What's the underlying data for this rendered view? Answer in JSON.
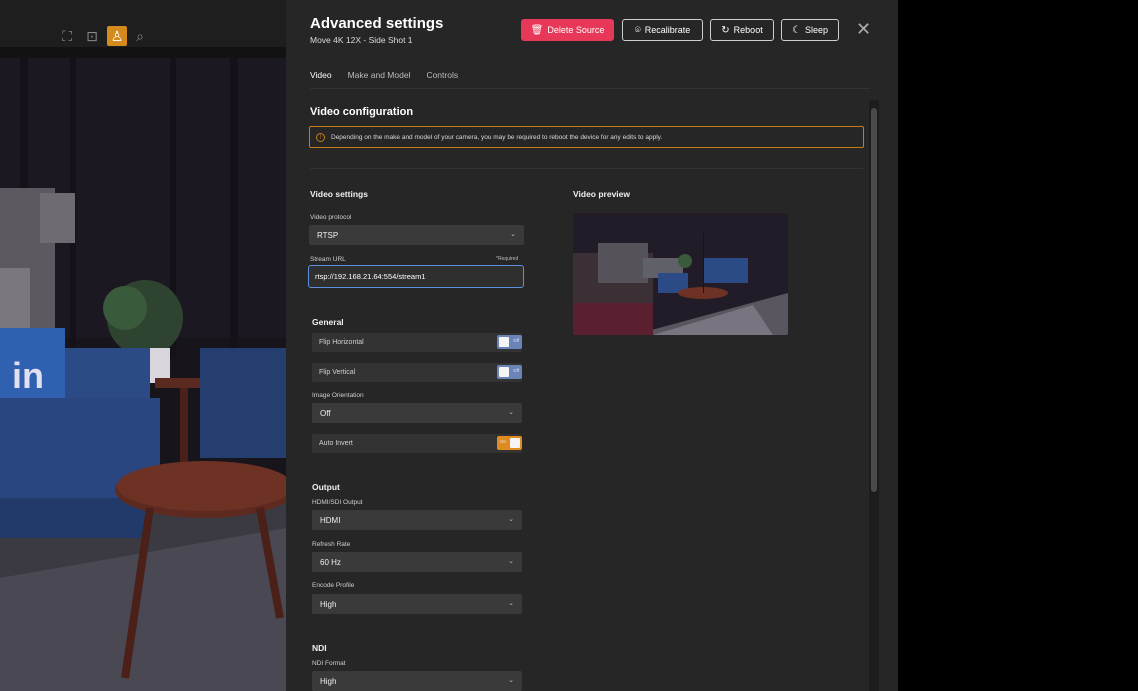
{
  "toolbar": {
    "icons": [
      "frame-select-icon",
      "frame-target-icon",
      "auto-track-icon",
      "zoom-icon"
    ]
  },
  "modal": {
    "title": "Advanced settings",
    "subtitle": "Move 4K 12X - Side Shot 1",
    "buttons": {
      "delete": "Delete Source",
      "recalibrate": "Recalibrate",
      "reboot": "Reboot",
      "sleep": "Sleep"
    },
    "tabs": [
      {
        "label": "Video"
      },
      {
        "label": "Make and Model"
      },
      {
        "label": "Controls"
      }
    ],
    "section_title": "Video configuration",
    "notice": "Depending on the make and model of your camera, you may be required to reboot the device for any edits to apply."
  },
  "video_settings": {
    "heading": "Video settings",
    "protocol_label": "Video protocol",
    "protocol_value": "RTSP",
    "stream_url_label": "Stream URL",
    "required_label": "*Required",
    "stream_url_value": "rtsp://192.168.21.64:554/stream1"
  },
  "video_preview": {
    "heading": "Video preview"
  },
  "general": {
    "heading": "General",
    "flip_horizontal": {
      "label": "Flip Horizontal",
      "state": "Off"
    },
    "flip_vertical": {
      "label": "Flip Vertical",
      "state": "Off"
    },
    "orientation_label": "Image Orientation",
    "orientation_value": "Off",
    "auto_invert": {
      "label": "Auto Invert",
      "state": "On"
    }
  },
  "output": {
    "heading": "Output",
    "hdmi_label": "HDMI/SDI Output",
    "hdmi_value": "HDMI",
    "refresh_label": "Refresh Rate",
    "refresh_value": "60 Hz",
    "encode_label": "Encode Profile",
    "encode_value": "High"
  },
  "ndi": {
    "heading": "NDI",
    "format_label": "NDI Format",
    "format_value": "High"
  },
  "colors": {
    "accent_danger": "#e8385a",
    "warning": "#c77d17",
    "toggle_on": "#e08a22",
    "toggle_off": "#6a84b8",
    "panel_bg": "#262626"
  }
}
